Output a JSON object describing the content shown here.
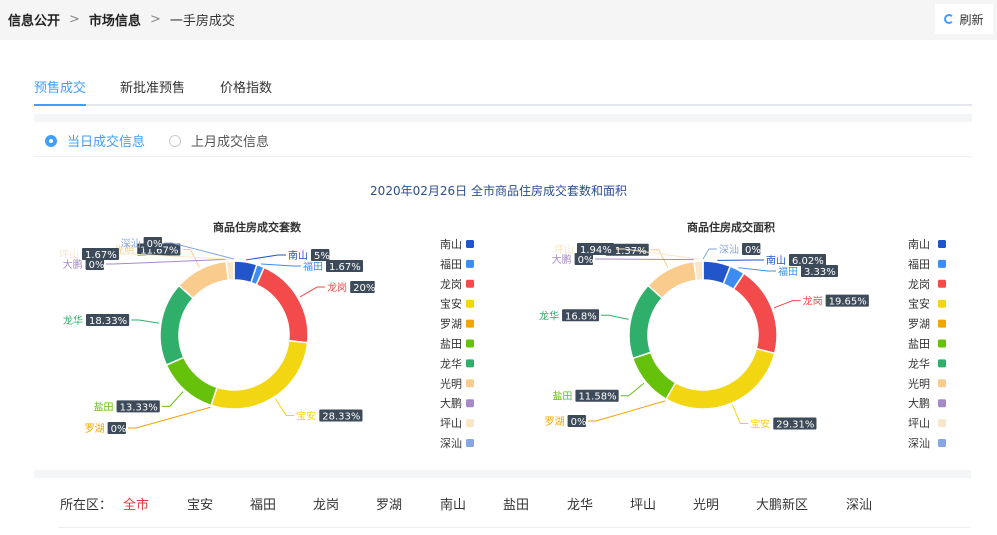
{
  "breadcrumb": {
    "items": [
      "信息公开",
      "市场信息",
      "一手房成交"
    ]
  },
  "refresh_label": "刷新",
  "tabs": [
    "预售成交",
    "新批准预售",
    "价格指数"
  ],
  "radios": [
    "当日成交信息",
    "上月成交信息"
  ],
  "main_title": "2020年02月26日 全市商品住房成交套数和面积",
  "district_filter": {
    "label": "所在区：",
    "options": [
      "全市",
      "宝安",
      "福田",
      "龙岗",
      "罗湖",
      "南山",
      "盐田",
      "龙华",
      "坪山",
      "光明",
      "大鹏新区",
      "深汕"
    ]
  },
  "colors": {
    "南山": "#2155c9",
    "福田": "#3c8cf2",
    "龙岗": "#f34b4b",
    "宝安": "#f3d612",
    "罗湖": "#f0a500",
    "盐田": "#66c10a",
    "龙华": "#2faf6a",
    "光明": "#f9cb8c",
    "大鹏": "#a68ac5",
    "坪山": "#f9e6c6",
    "深汕": "#85a6e0"
  },
  "chart_data": [
    {
      "type": "pie",
      "title": "商品住房成交套数",
      "categories": [
        "南山",
        "福田",
        "龙岗",
        "宝安",
        "罗湖",
        "盐田",
        "龙华",
        "光明",
        "大鹏",
        "坪山",
        "深汕"
      ],
      "values": [
        5,
        1.67,
        20,
        28.33,
        0,
        13.33,
        18.33,
        11.67,
        0,
        1.67,
        0
      ],
      "labels": [
        "5%",
        "1.67%",
        "20%",
        "28.33%",
        "0%",
        "13.33%",
        "18.33%",
        "11.67%",
        "0%",
        "1.67%",
        "0%"
      ],
      "legend": "right"
    },
    {
      "type": "pie",
      "title": "商品住房成交面积",
      "categories": [
        "南山",
        "福田",
        "龙岗",
        "宝安",
        "罗湖",
        "盐田",
        "龙华",
        "光明",
        "大鹏",
        "坪山",
        "深汕"
      ],
      "values": [
        6.02,
        3.33,
        19.65,
        29.31,
        0,
        11.58,
        16.8,
        11.37,
        0,
        1.94,
        0
      ],
      "labels": [
        "6.02%",
        "3.33%",
        "19.65%",
        "29.31%",
        "0%",
        "11.58%",
        "16.8%",
        "11.37%",
        "0%",
        "1.94%",
        "0%"
      ],
      "legend": "right"
    }
  ]
}
